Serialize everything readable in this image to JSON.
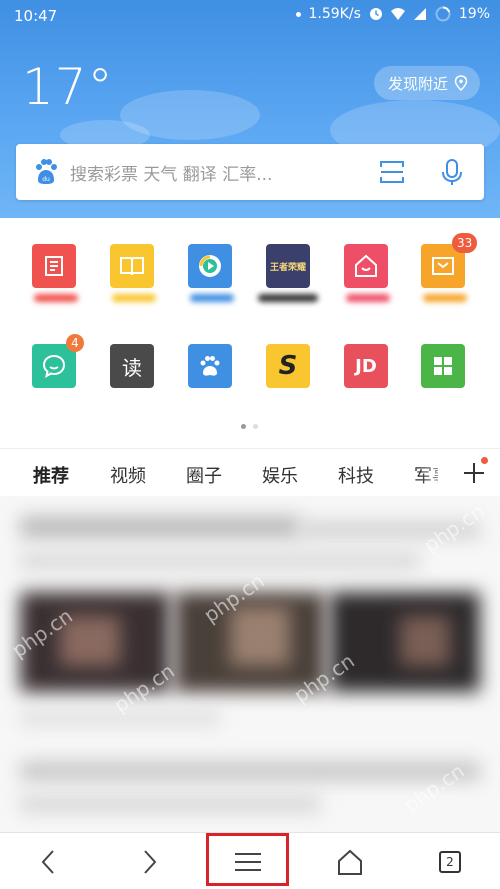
{
  "status_bar": {
    "time": "10:47",
    "speed": "1.59K/s",
    "battery": "19%"
  },
  "weather": {
    "temperature": "17°",
    "nearby_label": "发现附近"
  },
  "search": {
    "placeholder": "搜索彩票 天气 翻译 汇率..."
  },
  "apps": {
    "row1": [
      {
        "icon": "notes-icon",
        "color": "#f0524f"
      },
      {
        "icon": "book-icon",
        "color": "#f9c630"
      },
      {
        "icon": "video-player-icon",
        "color": "#3f8fe3"
      },
      {
        "icon": "game-king-glory-icon",
        "color": "#3a3f6b",
        "text": "王者荣耀"
      },
      {
        "icon": "home-chat-icon",
        "color": "#ef4f66"
      },
      {
        "icon": "mail-icon",
        "color": "#f6a52a",
        "badge": "33"
      }
    ],
    "row2": [
      {
        "icon": "chat-bubble-icon",
        "color": "#2cc19a",
        "badge": "4"
      },
      {
        "icon": "reader-icon",
        "color": "#4a4a4a",
        "text": "读"
      },
      {
        "icon": "baidu-paw-icon",
        "color": "#3f8fe3"
      },
      {
        "icon": "sohu-s-icon",
        "color": "#f9c630",
        "text": "S"
      },
      {
        "icon": "jd-icon",
        "color": "#e8505b",
        "text": "JD"
      },
      {
        "icon": "grid-apps-icon",
        "color": "#4cb548"
      }
    ]
  },
  "tabs": [
    "推荐",
    "视频",
    "圈子",
    "娱乐",
    "科技",
    "军事"
  ],
  "watermarks": [
    "php.cn",
    "php.cn",
    "php.cn",
    "php.cn",
    "php.cn",
    "php.cn"
  ],
  "nav": {
    "tab_count": "2"
  },
  "colors": {
    "header_blue": "#4a98ea",
    "badge_red": "#ef5b3d",
    "highlight_red": "#d9232a"
  }
}
